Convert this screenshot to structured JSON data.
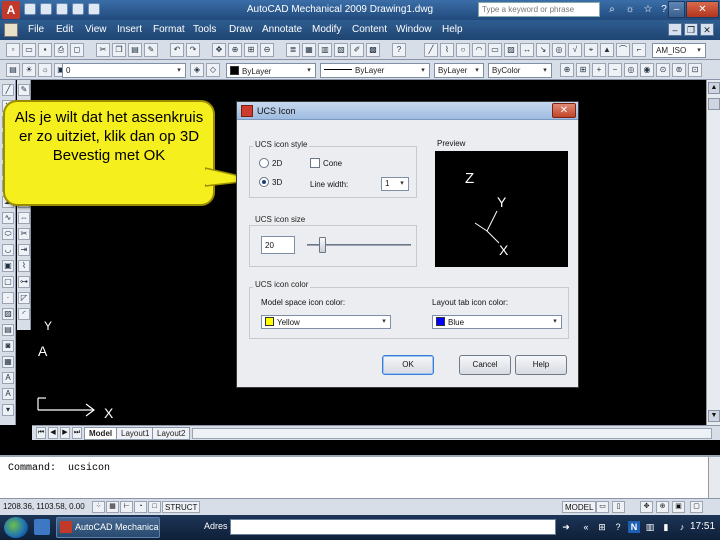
{
  "app": {
    "logo_letter": "A",
    "title": "AutoCAD Mechanical 2009 Drawing1.dwg",
    "search_placeholder": "Type a keyword or phrase",
    "window_controls": [
      "–",
      "❐",
      "✕"
    ]
  },
  "menu": {
    "items": [
      "File",
      "Edit",
      "View",
      "Insert",
      "Format",
      "Tools",
      "Draw",
      "Annotate",
      "Modify",
      "Content",
      "Window",
      "Help"
    ]
  },
  "toolbar": {
    "style_combo": "AM_ISO",
    "layer_combo": "0",
    "color_combo": "ByLayer",
    "linetype_combo": "ByLayer",
    "lineweight_combo": "ByLayer",
    "plotstyle_combo": "ByColor"
  },
  "canvas": {
    "ucs_x_label": "X",
    "ucs_y_label": "Y",
    "ucs_x2_label": "X",
    "colors": {
      "background": "#000000",
      "ucs": "#ffffff"
    }
  },
  "tabs": {
    "items": [
      "Model",
      "Layout1",
      "Layout2"
    ],
    "active": "Model"
  },
  "command": {
    "line": "Command:  ucsicon"
  },
  "status": {
    "coords": "1208.36, 1103.58, 0.00",
    "struct": "STRUCT",
    "model": "MODEL"
  },
  "taskbar": {
    "task_label": "AutoCAD Mechanical...",
    "address_label": "Adres",
    "clock": "17:51",
    "tray_letter": "N"
  },
  "callout": {
    "text": "Als je wilt dat het assenkruis er zo uitziet, klik dan op 3D Bevestig met OK",
    "color": "#f6ef1e"
  },
  "dialog": {
    "title": "UCS Icon",
    "close": "✕",
    "style": {
      "group_label": "UCS icon style",
      "option_2d": "2D",
      "option_3d": "3D",
      "cone_label": "Cone",
      "linewidth_label": "Line width:",
      "linewidth_value": "1"
    },
    "preview": {
      "label": "Preview",
      "z": "Z",
      "y": "Y",
      "x": "X"
    },
    "size": {
      "group_label": "UCS icon size",
      "value": "20",
      "slider_fraction": 0.12
    },
    "color": {
      "group_label": "UCS icon color",
      "model_label": "Model space icon color:",
      "model_value": "Yellow",
      "model_swatch": "#ffff00",
      "layout_label": "Layout tab icon color:",
      "layout_value": "Blue",
      "layout_swatch": "#0000ff"
    },
    "buttons": {
      "ok": "OK",
      "cancel": "Cancel",
      "help": "Help"
    }
  }
}
